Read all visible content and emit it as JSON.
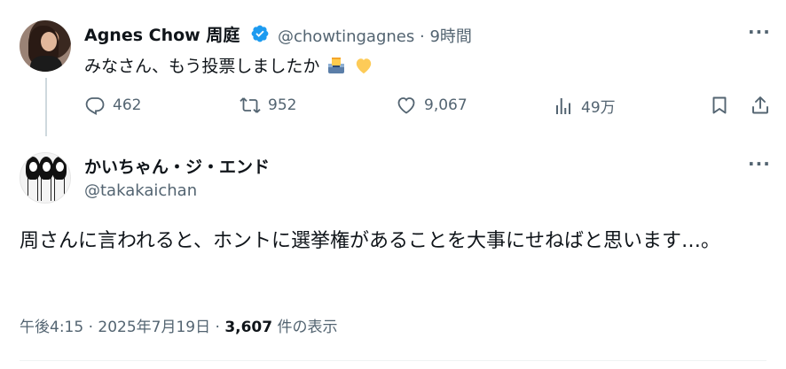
{
  "tweet1": {
    "display_name": "Agnes Chow 周庭",
    "handle": "@chowtingagnes",
    "separator": "·",
    "time": "9時間",
    "text": "みなさん、もう投票しましたか",
    "emojis": [
      "ballot-box-icon",
      "yellow-heart-icon"
    ],
    "more": "···"
  },
  "actions": {
    "reply_count": "462",
    "retweet_count": "952",
    "like_count": "9,067",
    "views_count": "49万"
  },
  "tweet2": {
    "display_name": "かいちゃん・ジ・エンド",
    "handle": "@takakaichan",
    "text": "周さんに言われると、ホントに選挙権があることを大事にせねばと思います…。",
    "more": "···",
    "timestamp": "午後4:15 · 2025年7月19日 · ",
    "views": "3,607",
    "views_suffix": " 件の表示"
  },
  "colors": {
    "text": "#0f1419",
    "secondary": "#536471",
    "verified": "#1d9bf0",
    "thread_line": "#cfd9de"
  }
}
